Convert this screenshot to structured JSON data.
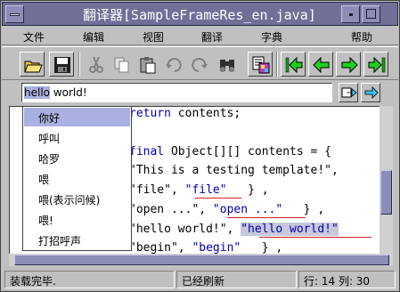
{
  "window": {
    "title_cjk": "翻译器",
    "title_file": "[SampleFrameRes_en.java]"
  },
  "menu": {
    "items": [
      "文件",
      "编辑",
      "视图",
      "翻译",
      "字典",
      "帮助"
    ]
  },
  "toolbar": {
    "buttons": [
      {
        "icon": "open-folder-icon"
      },
      {
        "icon": "save-disk-icon"
      },
      {
        "icon": "cut-scissors-icon"
      },
      {
        "icon": "copy-icon"
      },
      {
        "icon": "paste-clipboard-icon"
      },
      {
        "icon": "undo-icon"
      },
      {
        "icon": "redo-icon"
      },
      {
        "icon": "find-binoculars-icon"
      },
      {
        "icon": "translate-icon"
      },
      {
        "icon": "first-icon"
      },
      {
        "icon": "previous-icon"
      },
      {
        "icon": "next-icon"
      },
      {
        "icon": "last-icon"
      }
    ]
  },
  "search": {
    "selected_text": "hello",
    "rest_text": " world!"
  },
  "editor": {
    "lines": [
      "return contents;",
      "final Object[][] contents = {",
      "\"This is a testing template!\",",
      "\"file\", \"file\"   } ,",
      "\"open ...\", \"open ...\"   } ,",
      "\"hello world!\", \"hello world!\"",
      "\"begin\", \"begin\"   } ,"
    ]
  },
  "popup": {
    "items": [
      "你好",
      "呼叫",
      "哈罗",
      "喂",
      "喂(表示问候)",
      "喂!",
      "打招呼声"
    ],
    "active_index": 0
  },
  "status": {
    "left": "装载完毕.",
    "middle": "已经刷新",
    "position": "行: 14 列: 30"
  },
  "colors": {
    "titlebar": "#6f6f98",
    "selection": "#aab0e0",
    "error_underline": "#d02020",
    "string_blue": "#0000b0"
  }
}
